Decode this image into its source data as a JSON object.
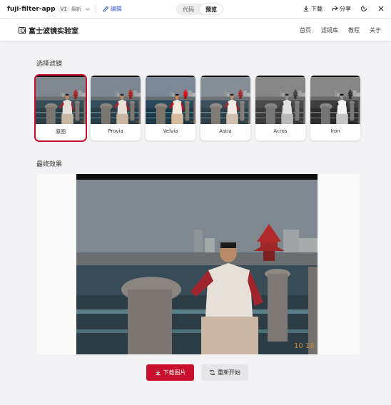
{
  "appbar": {
    "app_name": "fuji-filter-app",
    "version": "V1",
    "version_status": "最新",
    "edit_label": "编辑",
    "view_toggle": [
      "代码",
      "预览"
    ],
    "active_view": "预览",
    "download_label": "下载",
    "share_label": "分享"
  },
  "site": {
    "title": "富士滤镜实验室",
    "nav": [
      "首页",
      "滤镜库",
      "教程",
      "关于"
    ]
  },
  "filters_section": {
    "title": "选择滤镜",
    "selected": "原图",
    "items": [
      {
        "label": "原图"
      },
      {
        "label": "Provia"
      },
      {
        "label": "Velvia"
      },
      {
        "label": "Astia"
      },
      {
        "label": "Acros"
      },
      {
        "label": "Iron"
      }
    ]
  },
  "result_section": {
    "title": "最终效果"
  },
  "buttons": {
    "download": "下载图片",
    "restart": "重新开始"
  },
  "colors": {
    "accent": "#c8102e",
    "link": "#3b5bdb"
  },
  "icons": [
    "chevron-down-icon",
    "pencil-icon",
    "download-icon",
    "share-icon",
    "history-icon",
    "close-icon",
    "logo-icon",
    "refresh-icon"
  ]
}
